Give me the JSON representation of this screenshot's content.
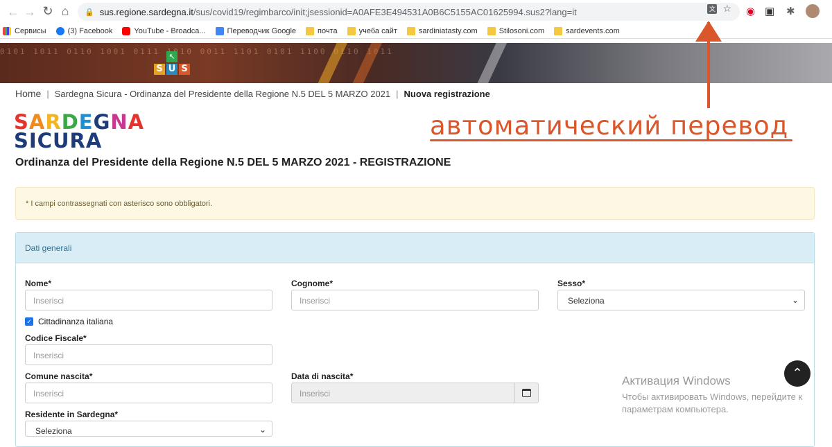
{
  "browser": {
    "url_host": "sus.regione.sardegna.it",
    "url_path": "/sus/covid19/regimbarco/init;jsessionid=A0AFE3E494531A0B6C5155AC01625994.sus2?lang=it",
    "bookmarks": [
      {
        "label": "Сервисы",
        "icon": "apps-grid-icon"
      },
      {
        "label": "(3) Facebook",
        "icon": "facebook-icon"
      },
      {
        "label": "YouTube - Broadca...",
        "icon": "youtube-icon"
      },
      {
        "label": "Переводчик Google",
        "icon": "google-translate-icon"
      },
      {
        "label": "почта",
        "icon": "folder-icon"
      },
      {
        "label": "учеба сайт",
        "icon": "folder-icon"
      },
      {
        "label": "sardiniatasty.com",
        "icon": "folder-icon"
      },
      {
        "label": "Stilosoni.com",
        "icon": "folder-icon"
      },
      {
        "label": "sardevents.com",
        "icon": "folder-icon"
      }
    ]
  },
  "banner": {
    "logo_letters": [
      "S",
      "U",
      "S"
    ]
  },
  "breadcrumb": {
    "home": "Home",
    "parent": "Sardegna Sicura - Ordinanza del Presidente della Regione N.5 DEL 5 MARZO 2021",
    "current": "Nuova registrazione"
  },
  "logo": {
    "line1": "SARDEGNA",
    "line2": "SICURA"
  },
  "annotation": "автоматический перевод",
  "page_title": "Ordinanza del Presidente della Regione N.5 DEL 5 MARZO 2021 - REGISTRAZIONE",
  "alert": "* I campi contrassegnati con asterisco sono obbligatori.",
  "panel": {
    "title": "Dati generali",
    "fields": {
      "nome": {
        "label": "Nome*",
        "placeholder": "Inserisci"
      },
      "cognome": {
        "label": "Cognome*",
        "placeholder": "Inserisci"
      },
      "sesso": {
        "label": "Sesso*",
        "value": "Seleziona"
      },
      "cittadinanza": {
        "label": "Cittadinanza italiana",
        "checked": true
      },
      "codice_fiscale": {
        "label": "Codice Fiscale*",
        "placeholder": "Inserisci"
      },
      "comune_nascita": {
        "label": "Comune nascita*",
        "placeholder": "Inserisci"
      },
      "data_nascita": {
        "label": "Data di nascita*",
        "placeholder": "Inserisci"
      },
      "residente": {
        "label": "Residente in Sardegna*",
        "value": "Seleziona"
      }
    }
  },
  "watermark": {
    "title": "Активация Windows",
    "line1": "Чтобы активировать Windows, перейдите к",
    "line2": "параметрам компьютера."
  },
  "colors": {
    "accent": "#d9572b",
    "panel_header": "#d9edf7",
    "alert_bg": "#fcf8e3",
    "logo_blue": "#1f3c7a"
  }
}
